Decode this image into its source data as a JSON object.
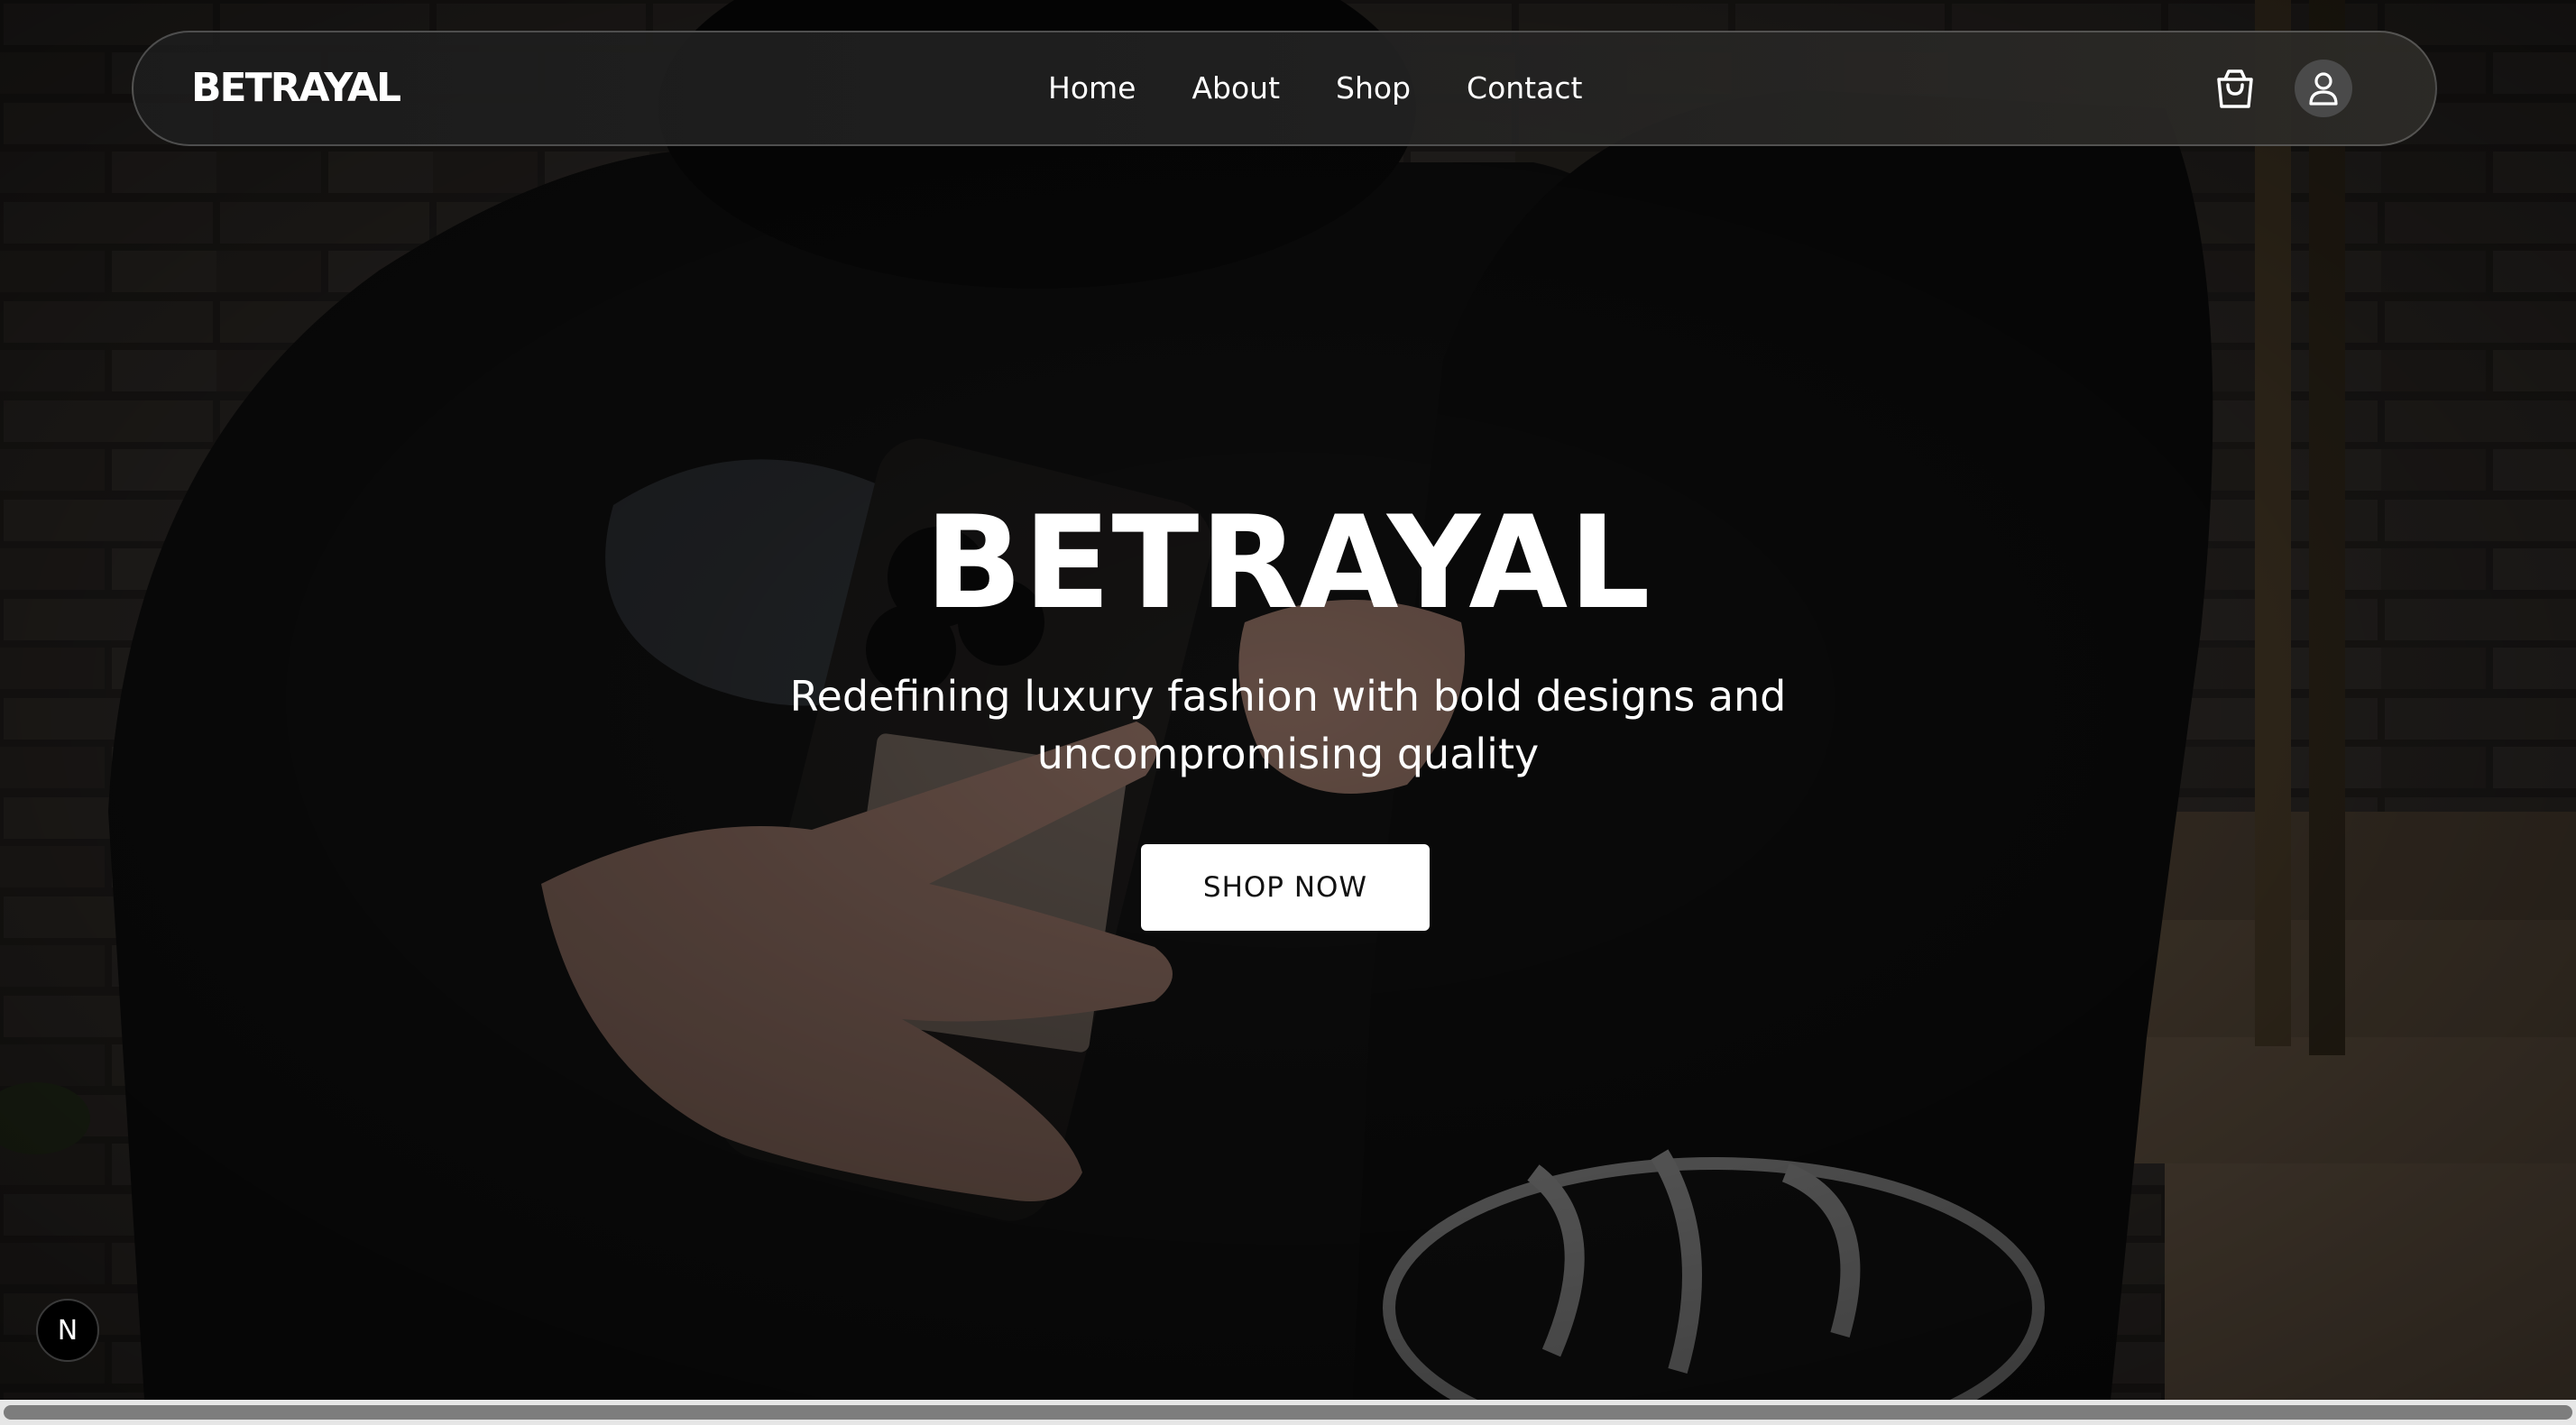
{
  "navbar": {
    "brand": "BETRAYAL",
    "links": [
      {
        "label": "Home"
      },
      {
        "label": "About"
      },
      {
        "label": "Shop"
      },
      {
        "label": "Contact"
      }
    ],
    "icons": {
      "cart": "shopping-bag-icon",
      "user": "user-icon"
    }
  },
  "hero": {
    "title": "BETRAYAL",
    "subtitle": "Redefining luxury fashion with bold designs and uncompromising quality",
    "cta_label": "SHOP NOW"
  },
  "dev_badge": {
    "label": "N"
  },
  "colors": {
    "text": "#ffffff",
    "cta_background": "#ffffff",
    "cta_text": "#111111",
    "navbar_background": "#1c1c1c"
  }
}
